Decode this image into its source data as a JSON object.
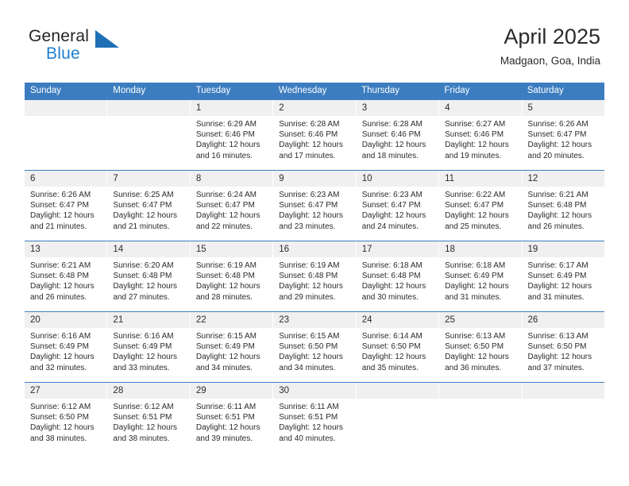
{
  "brand": {
    "name_part1": "General",
    "name_part2": "Blue",
    "mark": "blue-triangle-flag-icon"
  },
  "header": {
    "title": "April 2025",
    "subtitle": "Madgaon, Goa, India"
  },
  "colors": {
    "header_blue": "#3c7dc0",
    "brand_blue": "#1f7fd0",
    "day_head_gray": "#f0f0f0",
    "text": "#2b2b2b"
  },
  "weekdays": [
    "Sunday",
    "Monday",
    "Tuesday",
    "Wednesday",
    "Thursday",
    "Friday",
    "Saturday"
  ],
  "weeks": [
    [
      {
        "date": "",
        "sunrise": "",
        "sunset": "",
        "daylight_line1": "",
        "daylight_line2": "",
        "empty": true
      },
      {
        "date": "",
        "sunrise": "",
        "sunset": "",
        "daylight_line1": "",
        "daylight_line2": "",
        "empty": true
      },
      {
        "date": "1",
        "sunrise": "Sunrise: 6:29 AM",
        "sunset": "Sunset: 6:46 PM",
        "daylight_line1": "Daylight: 12 hours",
        "daylight_line2": "and 16 minutes."
      },
      {
        "date": "2",
        "sunrise": "Sunrise: 6:28 AM",
        "sunset": "Sunset: 6:46 PM",
        "daylight_line1": "Daylight: 12 hours",
        "daylight_line2": "and 17 minutes."
      },
      {
        "date": "3",
        "sunrise": "Sunrise: 6:28 AM",
        "sunset": "Sunset: 6:46 PM",
        "daylight_line1": "Daylight: 12 hours",
        "daylight_line2": "and 18 minutes."
      },
      {
        "date": "4",
        "sunrise": "Sunrise: 6:27 AM",
        "sunset": "Sunset: 6:46 PM",
        "daylight_line1": "Daylight: 12 hours",
        "daylight_line2": "and 19 minutes."
      },
      {
        "date": "5",
        "sunrise": "Sunrise: 6:26 AM",
        "sunset": "Sunset: 6:47 PM",
        "daylight_line1": "Daylight: 12 hours",
        "daylight_line2": "and 20 minutes."
      }
    ],
    [
      {
        "date": "6",
        "sunrise": "Sunrise: 6:26 AM",
        "sunset": "Sunset: 6:47 PM",
        "daylight_line1": "Daylight: 12 hours",
        "daylight_line2": "and 21 minutes."
      },
      {
        "date": "7",
        "sunrise": "Sunrise: 6:25 AM",
        "sunset": "Sunset: 6:47 PM",
        "daylight_line1": "Daylight: 12 hours",
        "daylight_line2": "and 21 minutes."
      },
      {
        "date": "8",
        "sunrise": "Sunrise: 6:24 AM",
        "sunset": "Sunset: 6:47 PM",
        "daylight_line1": "Daylight: 12 hours",
        "daylight_line2": "and 22 minutes."
      },
      {
        "date": "9",
        "sunrise": "Sunrise: 6:23 AM",
        "sunset": "Sunset: 6:47 PM",
        "daylight_line1": "Daylight: 12 hours",
        "daylight_line2": "and 23 minutes."
      },
      {
        "date": "10",
        "sunrise": "Sunrise: 6:23 AM",
        "sunset": "Sunset: 6:47 PM",
        "daylight_line1": "Daylight: 12 hours",
        "daylight_line2": "and 24 minutes."
      },
      {
        "date": "11",
        "sunrise": "Sunrise: 6:22 AM",
        "sunset": "Sunset: 6:47 PM",
        "daylight_line1": "Daylight: 12 hours",
        "daylight_line2": "and 25 minutes."
      },
      {
        "date": "12",
        "sunrise": "Sunrise: 6:21 AM",
        "sunset": "Sunset: 6:48 PM",
        "daylight_line1": "Daylight: 12 hours",
        "daylight_line2": "and 26 minutes."
      }
    ],
    [
      {
        "date": "13",
        "sunrise": "Sunrise: 6:21 AM",
        "sunset": "Sunset: 6:48 PM",
        "daylight_line1": "Daylight: 12 hours",
        "daylight_line2": "and 26 minutes."
      },
      {
        "date": "14",
        "sunrise": "Sunrise: 6:20 AM",
        "sunset": "Sunset: 6:48 PM",
        "daylight_line1": "Daylight: 12 hours",
        "daylight_line2": "and 27 minutes."
      },
      {
        "date": "15",
        "sunrise": "Sunrise: 6:19 AM",
        "sunset": "Sunset: 6:48 PM",
        "daylight_line1": "Daylight: 12 hours",
        "daylight_line2": "and 28 minutes."
      },
      {
        "date": "16",
        "sunrise": "Sunrise: 6:19 AM",
        "sunset": "Sunset: 6:48 PM",
        "daylight_line1": "Daylight: 12 hours",
        "daylight_line2": "and 29 minutes."
      },
      {
        "date": "17",
        "sunrise": "Sunrise: 6:18 AM",
        "sunset": "Sunset: 6:48 PM",
        "daylight_line1": "Daylight: 12 hours",
        "daylight_line2": "and 30 minutes."
      },
      {
        "date": "18",
        "sunrise": "Sunrise: 6:18 AM",
        "sunset": "Sunset: 6:49 PM",
        "daylight_line1": "Daylight: 12 hours",
        "daylight_line2": "and 31 minutes."
      },
      {
        "date": "19",
        "sunrise": "Sunrise: 6:17 AM",
        "sunset": "Sunset: 6:49 PM",
        "daylight_line1": "Daylight: 12 hours",
        "daylight_line2": "and 31 minutes."
      }
    ],
    [
      {
        "date": "20",
        "sunrise": "Sunrise: 6:16 AM",
        "sunset": "Sunset: 6:49 PM",
        "daylight_line1": "Daylight: 12 hours",
        "daylight_line2": "and 32 minutes."
      },
      {
        "date": "21",
        "sunrise": "Sunrise: 6:16 AM",
        "sunset": "Sunset: 6:49 PM",
        "daylight_line1": "Daylight: 12 hours",
        "daylight_line2": "and 33 minutes."
      },
      {
        "date": "22",
        "sunrise": "Sunrise: 6:15 AM",
        "sunset": "Sunset: 6:49 PM",
        "daylight_line1": "Daylight: 12 hours",
        "daylight_line2": "and 34 minutes."
      },
      {
        "date": "23",
        "sunrise": "Sunrise: 6:15 AM",
        "sunset": "Sunset: 6:50 PM",
        "daylight_line1": "Daylight: 12 hours",
        "daylight_line2": "and 34 minutes."
      },
      {
        "date": "24",
        "sunrise": "Sunrise: 6:14 AM",
        "sunset": "Sunset: 6:50 PM",
        "daylight_line1": "Daylight: 12 hours",
        "daylight_line2": "and 35 minutes."
      },
      {
        "date": "25",
        "sunrise": "Sunrise: 6:13 AM",
        "sunset": "Sunset: 6:50 PM",
        "daylight_line1": "Daylight: 12 hours",
        "daylight_line2": "and 36 minutes."
      },
      {
        "date": "26",
        "sunrise": "Sunrise: 6:13 AM",
        "sunset": "Sunset: 6:50 PM",
        "daylight_line1": "Daylight: 12 hours",
        "daylight_line2": "and 37 minutes."
      }
    ],
    [
      {
        "date": "27",
        "sunrise": "Sunrise: 6:12 AM",
        "sunset": "Sunset: 6:50 PM",
        "daylight_line1": "Daylight: 12 hours",
        "daylight_line2": "and 38 minutes."
      },
      {
        "date": "28",
        "sunrise": "Sunrise: 6:12 AM",
        "sunset": "Sunset: 6:51 PM",
        "daylight_line1": "Daylight: 12 hours",
        "daylight_line2": "and 38 minutes."
      },
      {
        "date": "29",
        "sunrise": "Sunrise: 6:11 AM",
        "sunset": "Sunset: 6:51 PM",
        "daylight_line1": "Daylight: 12 hours",
        "daylight_line2": "and 39 minutes."
      },
      {
        "date": "30",
        "sunrise": "Sunrise: 6:11 AM",
        "sunset": "Sunset: 6:51 PM",
        "daylight_line1": "Daylight: 12 hours",
        "daylight_line2": "and 40 minutes."
      },
      {
        "date": "",
        "sunrise": "",
        "sunset": "",
        "daylight_line1": "",
        "daylight_line2": "",
        "empty": true
      },
      {
        "date": "",
        "sunrise": "",
        "sunset": "",
        "daylight_line1": "",
        "daylight_line2": "",
        "empty": true
      },
      {
        "date": "",
        "sunrise": "",
        "sunset": "",
        "daylight_line1": "",
        "daylight_line2": "",
        "empty": true
      }
    ]
  ]
}
